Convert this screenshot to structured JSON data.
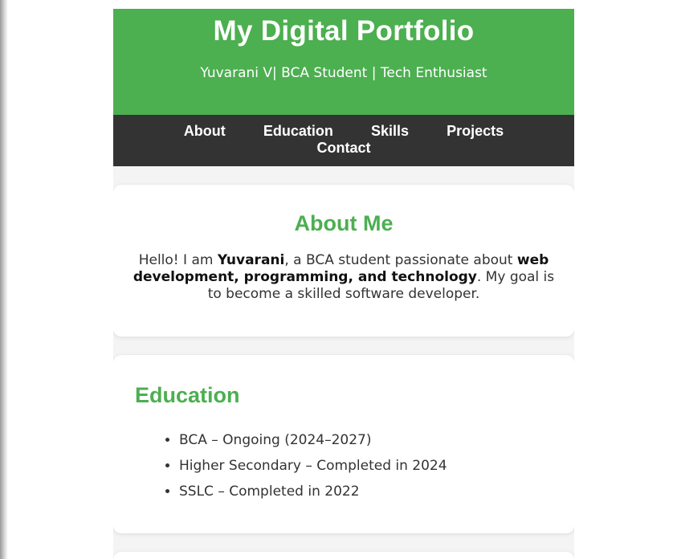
{
  "header": {
    "title": "My Digital Portfolio",
    "subtitle": "Yuvarani V| BCA Student | Tech Enthusiast"
  },
  "nav": {
    "items": [
      "About",
      "Education",
      "Skills",
      "Projects",
      "Contact"
    ]
  },
  "about": {
    "heading": "About Me",
    "text_1": "Hello! I am ",
    "name": "Yuvarani",
    "text_2": ", a BCA student passionate about ",
    "focus": "web development, programming, and technology",
    "text_3": ". My goal is to become a skilled software developer."
  },
  "education": {
    "heading": "Education",
    "items": [
      "BCA – Ongoing (2024–2027)",
      "Higher Secondary – Completed in 2024",
      "SSLC – Completed in 2022"
    ]
  },
  "colors": {
    "header_bg": "#4caf50",
    "nav_bg": "#333333",
    "accent": "#4caf50",
    "page_bg": "#f4f4f4"
  }
}
